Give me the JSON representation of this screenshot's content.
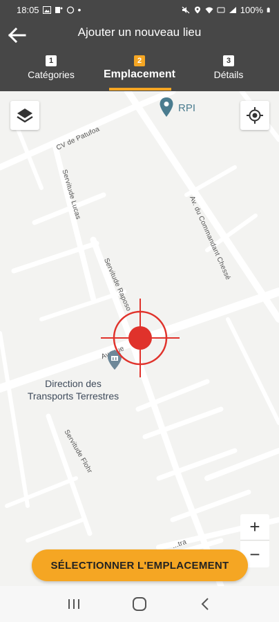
{
  "status_bar": {
    "time": "18:05",
    "dot": "•",
    "battery": "100%",
    "icons": [
      "image-icon",
      "teams-icon",
      "whatsapp-icon",
      "mute-icon",
      "location-icon",
      "wifi-icon",
      "volte-icon",
      "signal-icon",
      "battery-icon"
    ]
  },
  "header": {
    "title": "Ajouter un nouveau lieu",
    "back_icon": "arrow-left-icon"
  },
  "tabs": [
    {
      "number": "1",
      "label": "Catégories",
      "active": false
    },
    {
      "number": "2",
      "label": "Emplacement",
      "active": true
    },
    {
      "number": "3",
      "label": "Détails",
      "active": false
    }
  ],
  "map": {
    "layers_icon": "layers-icon",
    "locate_icon": "crosshair-gps-icon",
    "poi_rpi": "RPI",
    "poi_dtt_line1": "Direction des",
    "poi_dtt_line2": "Transports Terrestres",
    "streets": {
      "patufoa": "CV de Patufoa",
      "lucas": "Servitude Lucas",
      "raposo": "Servitude Raposo",
      "commandant": "Av. du Commandant Chessé",
      "flohr": "Servitude Flohr",
      "avenue": "Avenue",
      "bottom": "...tra"
    },
    "zoom_in": "+",
    "zoom_out": "−",
    "marker_icon": "target-crosshair-icon"
  },
  "actions": {
    "select_location": "SÉLECTIONNER L'EMPLACEMENT"
  },
  "nav_bar": {
    "icons": [
      "recent-apps-icon",
      "home-icon",
      "back-icon"
    ]
  },
  "colors": {
    "accent": "#f5a623",
    "header_bg": "#474747",
    "marker": "#e0322b"
  }
}
